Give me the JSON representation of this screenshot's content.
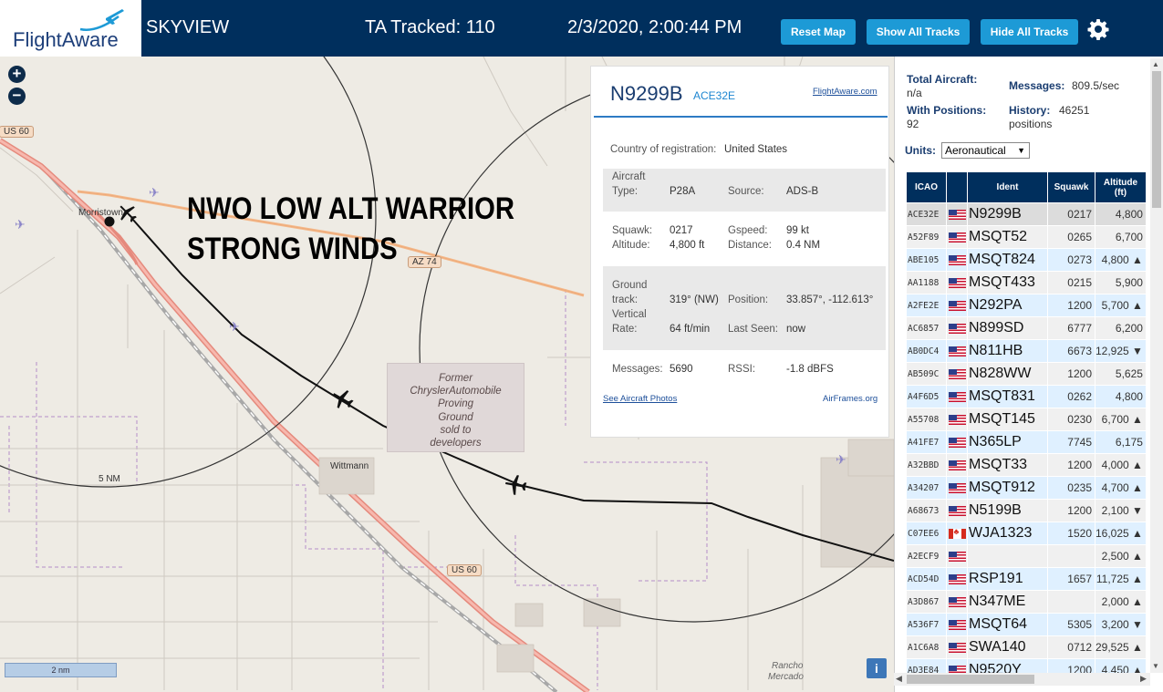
{
  "header": {
    "logo_text": "FlightAware",
    "site_name": "SKYVIEW",
    "tracked": "TA Tracked: 110",
    "datetime": "2/3/2020, 2:00:44 PM",
    "buttons": {
      "reset_map": "Reset Map",
      "show_all_tracks": "Show All Tracks",
      "hide_all_tracks": "Hide All Tracks"
    },
    "accent_color": "#1d9ad6",
    "bar_color": "#002f5d"
  },
  "map": {
    "zoom_in": "+",
    "zoom_out": "−",
    "overlay_line1": "NWO LOW ALT WARRIOR",
    "overlay_line2": "STRONG WINDS",
    "range_ring_label": "5 NM",
    "place_morristown": "Morristown",
    "place_wittmann": "Wittmann",
    "place_rancho_line1": "Rancho",
    "place_rancho_line2": "Mercado",
    "shield_us60_top": "US 60",
    "shield_us60_bottom": "US 60",
    "shield_az74": "AZ 74",
    "proving_ground": [
      "Former",
      "ChryslerAutomobile",
      "Proving",
      "Ground",
      "sold to",
      "developers"
    ],
    "scale_label": "2 nm",
    "info_button": "i"
  },
  "popup": {
    "registration": "N9299B",
    "hex": "ACE32E",
    "fa_link": "FlightAware.com",
    "country_label": "Country of registration:",
    "country_value": "United States",
    "aircraft_type_label_1": "Aircraft",
    "aircraft_type_label_2": "Type:",
    "aircraft_type_value": "P28A",
    "source_label": "Source:",
    "source_value": "ADS-B",
    "squawk_label": "Squawk:",
    "squawk_value": "0217",
    "gspeed_label": "Gspeed:",
    "gspeed_value": "99 kt",
    "altitude_label": "Altitude:",
    "altitude_value": "4,800 ft",
    "distance_label": "Distance:",
    "distance_value": "0.4 NM",
    "ground_track_label_1": "Ground",
    "ground_track_label_2": "track:",
    "ground_track_value": "319° (NW)",
    "position_label": "Position:",
    "position_value": "33.857°, -112.613°",
    "vertical_rate_label_1": "Vertical",
    "vertical_rate_label_2": "Rate:",
    "vertical_rate_value": "64 ft/min",
    "last_seen_label": "Last Seen:",
    "last_seen_value": "now",
    "messages_label": "Messages:",
    "messages_value": "5690",
    "rssi_label": "RSSI:",
    "rssi_value": "-1.8 dBFS",
    "photos_link": "See Aircraft Photos",
    "airframes_link": "AirFrames.org"
  },
  "panel": {
    "total_aircraft_label": "Total Aircraft:",
    "total_aircraft_value": "n/a",
    "messages_label": "Messages:",
    "messages_value": "809.5/sec",
    "with_positions_label": "With Positions:",
    "with_positions_value": "92",
    "history_label": "History:",
    "history_value": "46251",
    "history_unit": "positions",
    "units_label": "Units:",
    "units_value": "Aeronautical",
    "columns": {
      "icao": "ICAO",
      "ident": "Ident",
      "squawk": "Squawk",
      "altitude_1": "Altitude",
      "altitude_2": "(ft)"
    },
    "rows": [
      {
        "icao": "ACE32E",
        "flag": "us",
        "ident": "N9299B",
        "squawk": "0217",
        "alt": "4,800",
        "trend": ""
      },
      {
        "icao": "A52F89",
        "flag": "us",
        "ident": "MSQT52",
        "squawk": "0265",
        "alt": "6,700",
        "trend": ""
      },
      {
        "icao": "ABE105",
        "flag": "us",
        "ident": "MSQT824",
        "squawk": "0273",
        "alt": "4,800",
        "trend": "▲"
      },
      {
        "icao": "AA1188",
        "flag": "us",
        "ident": "MSQT433",
        "squawk": "0215",
        "alt": "5,900",
        "trend": ""
      },
      {
        "icao": "A2FE2E",
        "flag": "us",
        "ident": "N292PA",
        "squawk": "1200",
        "alt": "5,700",
        "trend": "▲"
      },
      {
        "icao": "AC6857",
        "flag": "us",
        "ident": "N899SD",
        "squawk": "6777",
        "alt": "6,200",
        "trend": ""
      },
      {
        "icao": "AB0DC4",
        "flag": "us",
        "ident": "N811HB",
        "squawk": "6673",
        "alt": "12,925",
        "trend": "▼"
      },
      {
        "icao": "AB509C",
        "flag": "us",
        "ident": "N828WW",
        "squawk": "1200",
        "alt": "5,625",
        "trend": ""
      },
      {
        "icao": "A4F6D5",
        "flag": "us",
        "ident": "MSQT831",
        "squawk": "0262",
        "alt": "4,800",
        "trend": ""
      },
      {
        "icao": "A55708",
        "flag": "us",
        "ident": "MSQT145",
        "squawk": "0230",
        "alt": "6,700",
        "trend": "▲"
      },
      {
        "icao": "A41FE7",
        "flag": "us",
        "ident": "N365LP",
        "squawk": "7745",
        "alt": "6,175",
        "trend": ""
      },
      {
        "icao": "A32BBD",
        "flag": "us",
        "ident": "MSQT33",
        "squawk": "1200",
        "alt": "4,000",
        "trend": "▲"
      },
      {
        "icao": "A34207",
        "flag": "us",
        "ident": "MSQT912",
        "squawk": "0235",
        "alt": "4,700",
        "trend": "▲"
      },
      {
        "icao": "A68673",
        "flag": "us",
        "ident": "N5199B",
        "squawk": "1200",
        "alt": "2,100",
        "trend": "▼"
      },
      {
        "icao": "C07EE6",
        "flag": "ca",
        "ident": "WJA1323",
        "squawk": "1520",
        "alt": "16,025",
        "trend": "▲"
      },
      {
        "icao": "A2ECF9",
        "flag": "us",
        "ident": "",
        "squawk": "",
        "alt": "2,500",
        "trend": "▲"
      },
      {
        "icao": "ACD54D",
        "flag": "us",
        "ident": "RSP191",
        "squawk": "1657",
        "alt": "11,725",
        "trend": "▲"
      },
      {
        "icao": "A3D867",
        "flag": "us",
        "ident": "N347ME",
        "squawk": "",
        "alt": "2,000",
        "trend": "▲"
      },
      {
        "icao": "A536F7",
        "flag": "us",
        "ident": "MSQT64",
        "squawk": "5305",
        "alt": "3,200",
        "trend": "▼"
      },
      {
        "icao": "A1C6A8",
        "flag": "us",
        "ident": "SWA140",
        "squawk": "0712",
        "alt": "29,525",
        "trend": "▲"
      },
      {
        "icao": "AD3E84",
        "flag": "us",
        "ident": "N9520Y",
        "squawk": "1200",
        "alt": "4,450",
        "trend": "▲"
      }
    ]
  }
}
